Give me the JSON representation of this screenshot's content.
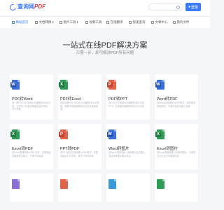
{
  "header": {
    "logo_text": "查询网",
    "logo_pdf": "PDF",
    "user_label": "登录"
  },
  "nav": [
    {
      "label": "网站首页",
      "icon": "home-icon"
    },
    {
      "label": "文档转换",
      "icon": "convert-icon"
    },
    {
      "label": "图片工具",
      "icon": "image-icon"
    },
    {
      "label": "视频工具",
      "icon": "video-icon"
    },
    {
      "label": "在线翻译",
      "icon": "translate-icon"
    },
    {
      "label": "快速查询",
      "icon": "query-icon"
    },
    {
      "label": "文章中心",
      "icon": "article-icon"
    },
    {
      "label": "我的文件",
      "icon": "file-icon"
    }
  ],
  "hero": {
    "title": "一站式在线PDF解决方案",
    "subtitle": "只需一步，即可解决PDF所有问题"
  },
  "cards": [
    {
      "title": "PDF转Word",
      "icon": "W",
      "color": "#3b6fd8",
      "desc": "将一款PDF文件转换为可编辑的Word文档，让您的工作更加快捷高效的完成PDF转换"
    },
    {
      "title": "PDF转Excel",
      "icon": "X",
      "color": "#2e9b57",
      "desc": "轻松转换PDF文件成为可编辑的Excel表格，数据识别准确率高并且支持批量转换"
    },
    {
      "title": "PDF转PPT",
      "icon": "P",
      "color": "#e2624a",
      "desc": "将PDF文件转换为可编辑的演示文档PPT，方便随时编辑修改幻灯片内容"
    },
    {
      "title": "Word转PDF",
      "icon": "W",
      "color": "#3b6fd8",
      "desc": "将Word文档转换为PDF格式，保持原有排版样式，方便在各种设备上查看"
    },
    {
      "title": "Excel转PDF",
      "icon": "X",
      "color": "#2e9b57",
      "desc": "将Excel表格转换为PDF文件，完美保留表格数据与格式，方便分享阅读"
    },
    {
      "title": "PPT转PDF",
      "icon": "P",
      "color": "#e2624a",
      "desc": "将PPT演示文档转换为PDF格式，完整保留幻灯片内容，便于打印和传阅"
    },
    {
      "title": "Word转图片",
      "icon": "W",
      "color": "#3b6fd8",
      "desc": "将Word文档的每一页转换为高清图片，支持多种图片格式导出"
    },
    {
      "title": "Excel转图片",
      "icon": "X",
      "color": "#2e9b57",
      "desc": "将Excel表格转换为清晰的图片，方便在社交平台分享数据内容"
    },
    {
      "title": "",
      "icon": "",
      "color": "#8b6fd6",
      "desc": ""
    },
    {
      "title": "",
      "icon": "",
      "color": "#e2624a",
      "desc": ""
    },
    {
      "title": "",
      "icon": "",
      "color": "#3b9bd8",
      "desc": ""
    },
    {
      "title": "",
      "icon": "",
      "color": "#2e9b57",
      "desc": ""
    }
  ]
}
